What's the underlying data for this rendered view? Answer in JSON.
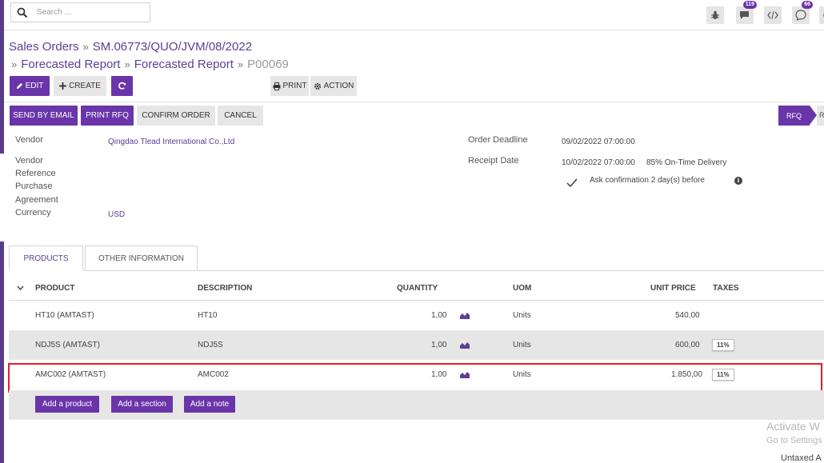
{
  "search": {
    "placeholder": "Search ..."
  },
  "topbar": {
    "badges": {
      "chat": "119",
      "messages": "66"
    }
  },
  "breadcrumb": {
    "items": [
      "Sales Orders",
      "SM.06773/QUO/JVM/08/2022",
      "Forecasted Report",
      "Forecasted Report"
    ],
    "current": "P00069",
    "separator": "»"
  },
  "control": {
    "edit": "EDIT",
    "create": "CREATE",
    "print": "PRINT",
    "action": "ACTION"
  },
  "header_buttons": {
    "send_by_email": "SEND BY EMAIL",
    "print_rfq": "PRINT RFQ",
    "confirm_order": "CONFIRM ORDER",
    "cancel": "CANCEL"
  },
  "status": {
    "active": "RFQ",
    "next": "R"
  },
  "form": {
    "vendor_label": "Vendor",
    "vendor_value": "Qingdao Tlead International Co.,Ltd",
    "vendor_reference_label_1": "Vendor",
    "vendor_reference_label_2": "Reference",
    "purchase_agreement_label_1": "Purchase",
    "purchase_agreement_label_2": "Agreement",
    "currency_label": "Currency",
    "currency_value": "USD",
    "order_deadline_label": "Order Deadline",
    "order_deadline_value": "09/02/2022 07:00:00",
    "receipt_date_label": "Receipt Date",
    "receipt_date_value": "10/02/2022 07:00:00",
    "on_time_delivery": "85% On-Time Delivery",
    "ask_confirmation": "Ask confirmation 2 day(s) before"
  },
  "tabs": [
    "PRODUCTS",
    "OTHER INFORMATION"
  ],
  "table": {
    "headers": {
      "product": "PRODUCT",
      "description": "DESCRIPTION",
      "quantity": "QUANTITY",
      "uom": "UOM",
      "unit_price": "UNIT PRICE",
      "taxes": "TAXES"
    },
    "rows": [
      {
        "product": "HT10 (AMTAST)",
        "description": "HT10",
        "quantity": "1,00",
        "uom": "Units",
        "unit_price": "540,00",
        "taxes": ""
      },
      {
        "product": "NDJ5S (AMTAST)",
        "description": "NDJ5S",
        "quantity": "1,00",
        "uom": "Units",
        "unit_price": "600,00",
        "taxes": "11%"
      },
      {
        "product": "AMC002 (AMTAST)",
        "description": "AMC002",
        "quantity": "1,00",
        "uom": "Units",
        "unit_price": "1.850,00",
        "taxes": "11%"
      }
    ],
    "add_product": "Add a product",
    "add_section": "Add a section",
    "add_note": "Add a note"
  },
  "watermark": {
    "line1": "Activate W",
    "line2": "Go to Settings"
  },
  "totals": {
    "untaxed_label": "Untaxed A"
  }
}
